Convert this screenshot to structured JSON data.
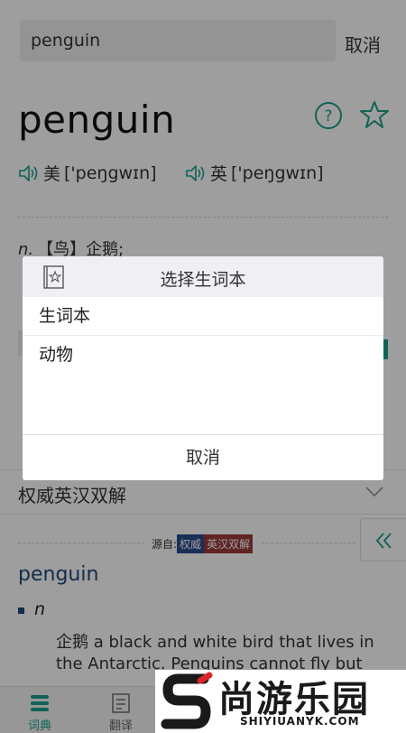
{
  "search": {
    "value": "penguin",
    "cancel_label": "取消"
  },
  "entry": {
    "headword": "penguin",
    "pron_us_label": "美",
    "pron_us": "['peŋgwɪn]",
    "pron_uk_label": "英",
    "pron_uk": "['peŋgwɪn]",
    "pos": "n.",
    "definition": "【鸟】企鹅;"
  },
  "authoritative": {
    "title": "权威英汉双解",
    "source_label": "源自:",
    "tag_blue": "权威",
    "tag_red": "英汉双解",
    "word": "penguin",
    "pos": "n",
    "definition": "企鹅 a black and white bird that lives in the Antarctic. Penguins cannot fly but"
  },
  "bottom_nav": {
    "dict_label": "词典",
    "trans_label": "翻译"
  },
  "logo": {
    "cn": "尚游乐园",
    "en": "SHIYIUANYK.COM"
  },
  "dialog": {
    "title": "选择生词本",
    "items": [
      "生词本",
      "动物"
    ],
    "cancel_label": "取消"
  },
  "colors": {
    "accent": "#1aa08c",
    "link": "#1e4a7a",
    "tag_blue": "#2a4d8f",
    "tag_red": "#9b3b3b"
  }
}
